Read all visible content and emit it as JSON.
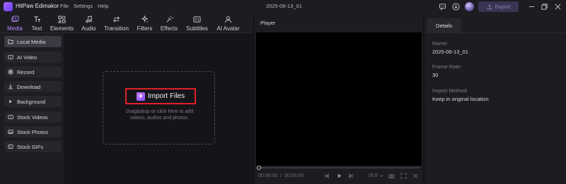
{
  "app": {
    "name": "HitPaw Edimakor",
    "document_title": "2025-06-13_01"
  },
  "menu": [
    "File",
    "Settings",
    "Help"
  ],
  "titlebar": {
    "export_label": "Export"
  },
  "tabs": [
    {
      "label": "Media",
      "icon": "media-icon",
      "active": true
    },
    {
      "label": "Text",
      "icon": "text-icon"
    },
    {
      "label": "Elements",
      "icon": "elements-icon"
    },
    {
      "label": "Audio",
      "icon": "audio-icon"
    },
    {
      "label": "Transition",
      "icon": "transition-icon"
    },
    {
      "label": "Filters",
      "icon": "filters-icon"
    },
    {
      "label": "Effects",
      "icon": "effects-icon"
    },
    {
      "label": "Subtitles",
      "icon": "subtitles-icon"
    },
    {
      "label": "AI Avatar",
      "icon": "ai-avatar-icon"
    }
  ],
  "sidebar": {
    "items": [
      {
        "label": "Local Media",
        "icon": "folder-icon",
        "active": true
      },
      {
        "label": "AI Video",
        "icon": "ai-video-icon"
      },
      {
        "label": "Record",
        "icon": "record-icon"
      },
      {
        "label": "Download",
        "icon": "download-icon"
      },
      {
        "label": "Background",
        "icon": "background-icon"
      },
      {
        "label": "Stock Videos",
        "icon": "stock-videos-icon"
      },
      {
        "label": "Stock Photos",
        "icon": "stock-photos-icon"
      },
      {
        "label": "Stock GIFs",
        "icon": "stock-gifs-icon"
      }
    ]
  },
  "media": {
    "import_label": "Import Files",
    "hint_line1": "Drag&drop or click here to add",
    "hint_line2": "videos, audios and photos."
  },
  "player": {
    "title": "Player",
    "time_current": "00:00:00",
    "time_separator": "/",
    "time_total": "00:00:00",
    "aspect_ratio": "16:9"
  },
  "details": {
    "tab_label": "Details",
    "name_label": "Name:",
    "name_value": "2025-06-13_01",
    "frame_rate_label": "Frame Rate:",
    "frame_rate_value": "30",
    "import_method_label": "Import Method:",
    "import_method_value": "Keep in original location"
  },
  "colors": {
    "accent": "#b58cff",
    "highlight": "#e0202a",
    "background": "#151519",
    "panel": "#1c1c21"
  }
}
